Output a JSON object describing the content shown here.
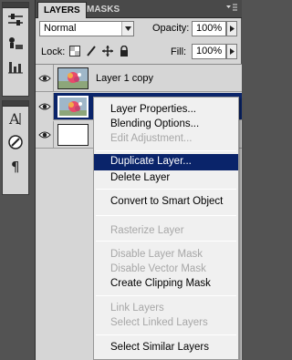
{
  "panel": {
    "tabs": [
      {
        "label": "LAYERS"
      },
      {
        "label": "MASKS"
      }
    ],
    "blend_mode": "Normal",
    "opacity_label": "Opacity:",
    "opacity_value": "100%",
    "lock_label": "Lock:",
    "fill_label": "Fill:",
    "fill_value": "100%"
  },
  "layers": [
    {
      "name": "Layer 1 copy",
      "visible": true,
      "selected": false
    },
    {
      "name": "",
      "visible": true,
      "selected": true
    },
    {
      "name": "",
      "visible": true,
      "selected": false
    }
  ],
  "context_menu": {
    "items": [
      {
        "label": "Layer Properties...",
        "enabled": true
      },
      {
        "label": "Blending Options...",
        "enabled": true
      },
      {
        "label": "Edit Adjustment...",
        "enabled": false
      },
      {
        "label": "Duplicate Layer...",
        "enabled": true,
        "highlighted": true
      },
      {
        "label": "Delete Layer",
        "enabled": true
      },
      {
        "label": "Convert to Smart Object",
        "enabled": true
      },
      {
        "label": "Rasterize Layer",
        "enabled": false
      },
      {
        "label": "Disable Layer Mask",
        "enabled": false
      },
      {
        "label": "Disable Vector Mask",
        "enabled": false
      },
      {
        "label": "Create Clipping Mask",
        "enabled": true
      },
      {
        "label": "Link Layers",
        "enabled": false
      },
      {
        "label": "Select Linked Layers",
        "enabled": false
      },
      {
        "label": "Select Similar Layers",
        "enabled": true
      }
    ]
  },
  "colors": {
    "highlight": "#0a246a",
    "panel_bg": "#d6d6d6",
    "app_bg": "#535353",
    "disabled_text": "#a7a7a7"
  },
  "icons": [
    "sliders-icon",
    "clone-stamp-icon",
    "histogram-icon",
    "text-tool-icon",
    "no-entry-icon",
    "paragraph-icon",
    "eye-icon",
    "panel-menu-icon",
    "lock-transparent-icon",
    "lock-paint-icon",
    "lock-move-icon",
    "lock-all-icon"
  ]
}
